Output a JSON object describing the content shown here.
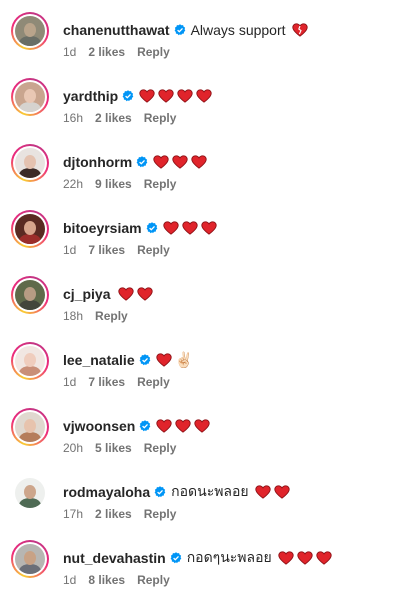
{
  "colors": {
    "verified_blue": "#0095f6",
    "heart_red": "#e0242b",
    "meta_gray": "#737373"
  },
  "comments": [
    {
      "user": "chanenutthawat",
      "verified": true,
      "text": "Always support",
      "hearts": 1,
      "extra_emoji": "",
      "heart_icon": "heart-broken-icon",
      "time": "1d",
      "likes": "2 likes",
      "reply": "Reply",
      "story_ring": true,
      "avatar": {
        "skin": "#b9a48b",
        "body": "#6a6e66",
        "bg": "#8f8a77"
      }
    },
    {
      "user": "yardthip",
      "verified": true,
      "text": "",
      "hearts": 4,
      "extra_emoji": "",
      "heart_icon": "heart-icon",
      "time": "16h",
      "likes": "2 likes",
      "reply": "Reply",
      "story_ring": true,
      "avatar": {
        "skin": "#e9c7b4",
        "body": "#d6d3cf",
        "bg": "#c9a58f"
      }
    },
    {
      "user": "djtonhorm",
      "verified": true,
      "text": "",
      "hearts": 3,
      "extra_emoji": "",
      "heart_icon": "heart-icon",
      "time": "22h",
      "likes": "9 likes",
      "reply": "Reply",
      "story_ring": true,
      "avatar": {
        "skin": "#e4c2b0",
        "body": "#3b2a26",
        "bg": "#e8e3e0"
      }
    },
    {
      "user": "bitoeyrsiam",
      "verified": true,
      "text": "",
      "hearts": 3,
      "extra_emoji": "",
      "heart_icon": "heart-icon",
      "time": "1d",
      "likes": "7 likes",
      "reply": "Reply",
      "story_ring": true,
      "avatar": {
        "skin": "#d7a48c",
        "body": "#9b2d2a",
        "bg": "#5a2a22"
      }
    },
    {
      "user": "cj_piya",
      "verified": false,
      "text": "",
      "hearts": 2,
      "extra_emoji": "",
      "heart_icon": "heart-icon",
      "time": "18h",
      "likes": "",
      "reply": "Reply",
      "story_ring": true,
      "avatar": {
        "skin": "#b79c83",
        "body": "#43463b",
        "bg": "#5f6a4a"
      }
    },
    {
      "user": "lee_natalie",
      "verified": true,
      "text": "",
      "hearts": 1,
      "extra_emoji": "✌🏻",
      "heart_icon": "heart-icon",
      "time": "1d",
      "likes": "7 likes",
      "reply": "Reply",
      "story_ring": true,
      "avatar": {
        "skin": "#efcdbd",
        "body": "#c98f78",
        "bg": "#f1e7e2"
      }
    },
    {
      "user": "vjwoonsen",
      "verified": true,
      "text": "",
      "hearts": 3,
      "extra_emoji": "",
      "heart_icon": "heart-icon",
      "time": "20h",
      "likes": "5 likes",
      "reply": "Reply",
      "story_ring": true,
      "avatar": {
        "skin": "#e7c3ad",
        "body": "#b57d5b",
        "bg": "#e0d8cf"
      }
    },
    {
      "user": "rodmayaloha",
      "verified": true,
      "text": "กอดนะพลอย",
      "hearts": 2,
      "extra_emoji": "",
      "heart_icon": "heart-icon",
      "time": "17h",
      "likes": "2 likes",
      "reply": "Reply",
      "story_ring": false,
      "avatar": {
        "skin": "#cda68c",
        "body": "#4f6b55",
        "bg": "#eef0ee"
      }
    },
    {
      "user": "nut_devahastin",
      "verified": true,
      "text": "กอดๆนะพลอย",
      "hearts": 3,
      "extra_emoji": "",
      "heart_icon": "heart-icon",
      "time": "1d",
      "likes": "8 likes",
      "reply": "Reply",
      "story_ring": true,
      "avatar": {
        "skin": "#c8a285",
        "body": "#6b6f78",
        "bg": "#b7b6b2"
      }
    }
  ]
}
